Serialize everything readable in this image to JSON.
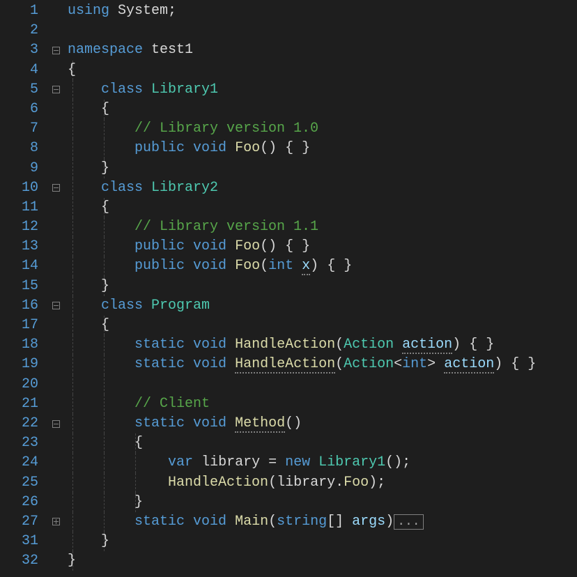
{
  "lines": {
    "l1": "1",
    "l2": "2",
    "l3": "3",
    "l4": "4",
    "l5": "5",
    "l6": "6",
    "l7": "7",
    "l8": "8",
    "l9": "9",
    "l10": "10",
    "l11": "11",
    "l12": "12",
    "l13": "13",
    "l14": "14",
    "l15": "15",
    "l16": "16",
    "l17": "17",
    "l18": "18",
    "l19": "19",
    "l20": "20",
    "l21": "21",
    "l22": "22",
    "l23": "23",
    "l24": "24",
    "l25": "25",
    "l26": "26",
    "l27": "27",
    "l31": "31",
    "l32": "32"
  },
  "code": {
    "using": "using",
    "system": "System",
    "namespace": "namespace",
    "ns": "test1",
    "class": "class",
    "lib1": "Library1",
    "lib2": "Library2",
    "program": "Program",
    "public": "public",
    "void": "void",
    "static": "static",
    "var": "var",
    "new": "new",
    "foo": "Foo",
    "handle": "HandleAction",
    "method": "Method",
    "main": "Main",
    "action": "Action",
    "actionp": "action",
    "int": "int",
    "x": "x",
    "string": "string",
    "args": "args",
    "lib": "library",
    "cmt_v10": "// Library version 1.0",
    "cmt_v11": "// Library version 1.1",
    "cmt_client": "// Client",
    "ob": "{",
    "cb": "}",
    "op": "(",
    "cp": ")",
    "sc": ";",
    "eq": " = ",
    "obcb": "{ }",
    "opcp": "()",
    "osb": "[",
    "csb": "]",
    "lt": "<",
    "gt": ">",
    "dot": ".",
    "ellipsis": "..."
  }
}
